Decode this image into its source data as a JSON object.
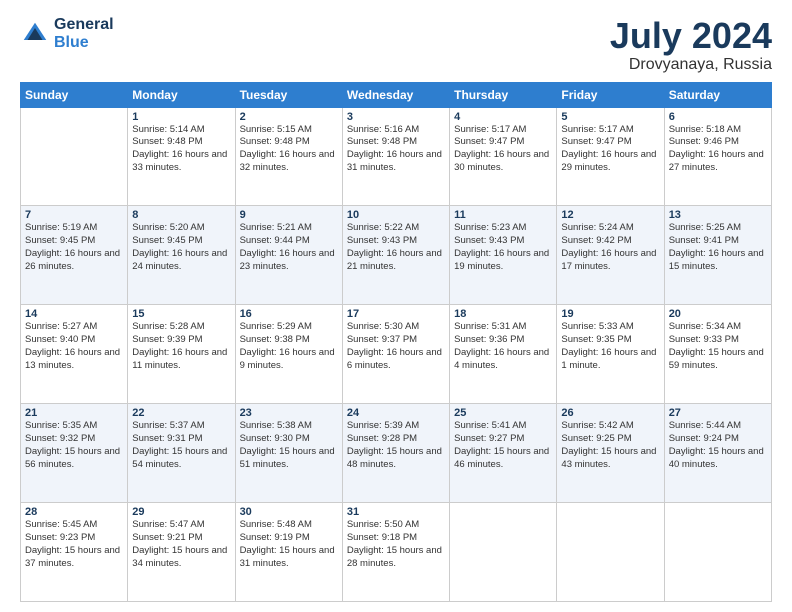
{
  "logo": {
    "general": "General",
    "blue": "Blue"
  },
  "title": "July 2024",
  "subtitle": "Drovyanaya, Russia",
  "days_of_week": [
    "Sunday",
    "Monday",
    "Tuesday",
    "Wednesday",
    "Thursday",
    "Friday",
    "Saturday"
  ],
  "weeks": [
    [
      {
        "day": "",
        "sunrise": "",
        "sunset": "",
        "daylight": ""
      },
      {
        "day": "1",
        "sunrise": "Sunrise: 5:14 AM",
        "sunset": "Sunset: 9:48 PM",
        "daylight": "Daylight: 16 hours and 33 minutes."
      },
      {
        "day": "2",
        "sunrise": "Sunrise: 5:15 AM",
        "sunset": "Sunset: 9:48 PM",
        "daylight": "Daylight: 16 hours and 32 minutes."
      },
      {
        "day": "3",
        "sunrise": "Sunrise: 5:16 AM",
        "sunset": "Sunset: 9:48 PM",
        "daylight": "Daylight: 16 hours and 31 minutes."
      },
      {
        "day": "4",
        "sunrise": "Sunrise: 5:17 AM",
        "sunset": "Sunset: 9:47 PM",
        "daylight": "Daylight: 16 hours and 30 minutes."
      },
      {
        "day": "5",
        "sunrise": "Sunrise: 5:17 AM",
        "sunset": "Sunset: 9:47 PM",
        "daylight": "Daylight: 16 hours and 29 minutes."
      },
      {
        "day": "6",
        "sunrise": "Sunrise: 5:18 AM",
        "sunset": "Sunset: 9:46 PM",
        "daylight": "Daylight: 16 hours and 27 minutes."
      }
    ],
    [
      {
        "day": "7",
        "sunrise": "Sunrise: 5:19 AM",
        "sunset": "Sunset: 9:45 PM",
        "daylight": "Daylight: 16 hours and 26 minutes."
      },
      {
        "day": "8",
        "sunrise": "Sunrise: 5:20 AM",
        "sunset": "Sunset: 9:45 PM",
        "daylight": "Daylight: 16 hours and 24 minutes."
      },
      {
        "day": "9",
        "sunrise": "Sunrise: 5:21 AM",
        "sunset": "Sunset: 9:44 PM",
        "daylight": "Daylight: 16 hours and 23 minutes."
      },
      {
        "day": "10",
        "sunrise": "Sunrise: 5:22 AM",
        "sunset": "Sunset: 9:43 PM",
        "daylight": "Daylight: 16 hours and 21 minutes."
      },
      {
        "day": "11",
        "sunrise": "Sunrise: 5:23 AM",
        "sunset": "Sunset: 9:43 PM",
        "daylight": "Daylight: 16 hours and 19 minutes."
      },
      {
        "day": "12",
        "sunrise": "Sunrise: 5:24 AM",
        "sunset": "Sunset: 9:42 PM",
        "daylight": "Daylight: 16 hours and 17 minutes."
      },
      {
        "day": "13",
        "sunrise": "Sunrise: 5:25 AM",
        "sunset": "Sunset: 9:41 PM",
        "daylight": "Daylight: 16 hours and 15 minutes."
      }
    ],
    [
      {
        "day": "14",
        "sunrise": "Sunrise: 5:27 AM",
        "sunset": "Sunset: 9:40 PM",
        "daylight": "Daylight: 16 hours and 13 minutes."
      },
      {
        "day": "15",
        "sunrise": "Sunrise: 5:28 AM",
        "sunset": "Sunset: 9:39 PM",
        "daylight": "Daylight: 16 hours and 11 minutes."
      },
      {
        "day": "16",
        "sunrise": "Sunrise: 5:29 AM",
        "sunset": "Sunset: 9:38 PM",
        "daylight": "Daylight: 16 hours and 9 minutes."
      },
      {
        "day": "17",
        "sunrise": "Sunrise: 5:30 AM",
        "sunset": "Sunset: 9:37 PM",
        "daylight": "Daylight: 16 hours and 6 minutes."
      },
      {
        "day": "18",
        "sunrise": "Sunrise: 5:31 AM",
        "sunset": "Sunset: 9:36 PM",
        "daylight": "Daylight: 16 hours and 4 minutes."
      },
      {
        "day": "19",
        "sunrise": "Sunrise: 5:33 AM",
        "sunset": "Sunset: 9:35 PM",
        "daylight": "Daylight: 16 hours and 1 minute."
      },
      {
        "day": "20",
        "sunrise": "Sunrise: 5:34 AM",
        "sunset": "Sunset: 9:33 PM",
        "daylight": "Daylight: 15 hours and 59 minutes."
      }
    ],
    [
      {
        "day": "21",
        "sunrise": "Sunrise: 5:35 AM",
        "sunset": "Sunset: 9:32 PM",
        "daylight": "Daylight: 15 hours and 56 minutes."
      },
      {
        "day": "22",
        "sunrise": "Sunrise: 5:37 AM",
        "sunset": "Sunset: 9:31 PM",
        "daylight": "Daylight: 15 hours and 54 minutes."
      },
      {
        "day": "23",
        "sunrise": "Sunrise: 5:38 AM",
        "sunset": "Sunset: 9:30 PM",
        "daylight": "Daylight: 15 hours and 51 minutes."
      },
      {
        "day": "24",
        "sunrise": "Sunrise: 5:39 AM",
        "sunset": "Sunset: 9:28 PM",
        "daylight": "Daylight: 15 hours and 48 minutes."
      },
      {
        "day": "25",
        "sunrise": "Sunrise: 5:41 AM",
        "sunset": "Sunset: 9:27 PM",
        "daylight": "Daylight: 15 hours and 46 minutes."
      },
      {
        "day": "26",
        "sunrise": "Sunrise: 5:42 AM",
        "sunset": "Sunset: 9:25 PM",
        "daylight": "Daylight: 15 hours and 43 minutes."
      },
      {
        "day": "27",
        "sunrise": "Sunrise: 5:44 AM",
        "sunset": "Sunset: 9:24 PM",
        "daylight": "Daylight: 15 hours and 40 minutes."
      }
    ],
    [
      {
        "day": "28",
        "sunrise": "Sunrise: 5:45 AM",
        "sunset": "Sunset: 9:23 PM",
        "daylight": "Daylight: 15 hours and 37 minutes."
      },
      {
        "day": "29",
        "sunrise": "Sunrise: 5:47 AM",
        "sunset": "Sunset: 9:21 PM",
        "daylight": "Daylight: 15 hours and 34 minutes."
      },
      {
        "day": "30",
        "sunrise": "Sunrise: 5:48 AM",
        "sunset": "Sunset: 9:19 PM",
        "daylight": "Daylight: 15 hours and 31 minutes."
      },
      {
        "day": "31",
        "sunrise": "Sunrise: 5:50 AM",
        "sunset": "Sunset: 9:18 PM",
        "daylight": "Daylight: 15 hours and 28 minutes."
      },
      {
        "day": "",
        "sunrise": "",
        "sunset": "",
        "daylight": ""
      },
      {
        "day": "",
        "sunrise": "",
        "sunset": "",
        "daylight": ""
      },
      {
        "day": "",
        "sunrise": "",
        "sunset": "",
        "daylight": ""
      }
    ]
  ]
}
